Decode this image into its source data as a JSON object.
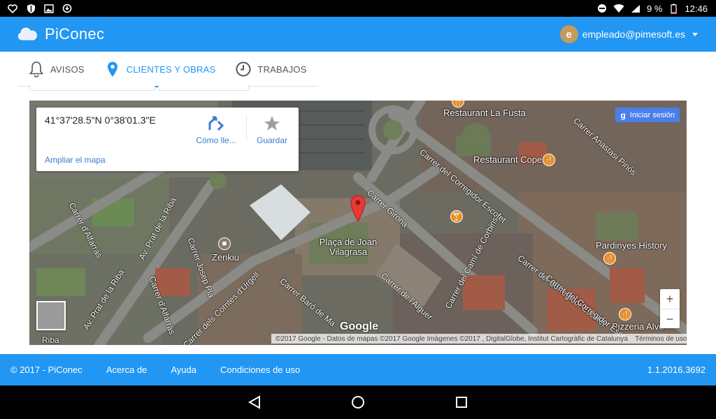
{
  "statusbar": {
    "battery": "9 %",
    "time": "12:46"
  },
  "app": {
    "title": "PiConec",
    "user_initial": "e",
    "user_email": "empleado@pimesoft.es"
  },
  "tabs": [
    {
      "label": "AVISOS",
      "icon": "bell-icon",
      "active": false
    },
    {
      "label": "CLIENTES Y OBRAS",
      "icon": "map-pin-icon",
      "active": true
    },
    {
      "label": "TRABAJOS",
      "icon": "clock-icon",
      "active": false
    }
  ],
  "map": {
    "coords": "41°37'28.5\"N 0°38'01.3\"E",
    "directions_label": "Cómo lle...",
    "save_label": "Guardar",
    "enlarge_label": "Ampliar el mapa",
    "signin_label": "Iniciar sesión",
    "zoom_in": "+",
    "zoom_out": "−",
    "logo": "Google",
    "attribution": "©2017 Google - Datos de mapas ©2017 Google Imágenes ©2017 , DigitalGlobe, Institut Cartogràfic de Catalunya",
    "terms": "Términos de uso",
    "places": {
      "restaurant_la_fusta": "Restaurant La Fusta",
      "restaurant_cope": "Restaurant Cope",
      "placa": "Plaça de Joan Vilagrasa",
      "zenkiu": "Zenkiu",
      "pardinyes": "Pardinyes History",
      "pizzeria": "Pizzeria Alvo"
    },
    "streets": {
      "alfarras": "Carrer d'Alfarràs",
      "prat_riba_1": "Av. Prat de la Riba",
      "prat_riba_2": "Av. Prat de la Riba",
      "alfarras_2": "Carrer d'Alfarràs",
      "josep_pla": "Carrer Josep Pla",
      "comtes": "Carrer dels Comtes d'Urgell",
      "girona": "Carrer Girona",
      "corregidor_1": "Carrer del Corregidor Escofet",
      "corregidor_2": "Carrer del Corregidor Escofet",
      "corregidor_3": "Carrer del Corregidor Escof",
      "anastasi": "Carrer Anastasi Pinós",
      "alguer": "Carrer de l'Alguer",
      "cami": "Carrer del Camí de Corbins",
      "baro": "Carrer Baró de Ma",
      "ribadeneyra": "Riba"
    }
  },
  "footer": {
    "copyright": "© 2017 - PiConec",
    "about": "Acerca de",
    "help": "Ayuda",
    "terms": "Condiciones de uso",
    "version": "1.1.2016.3692"
  }
}
